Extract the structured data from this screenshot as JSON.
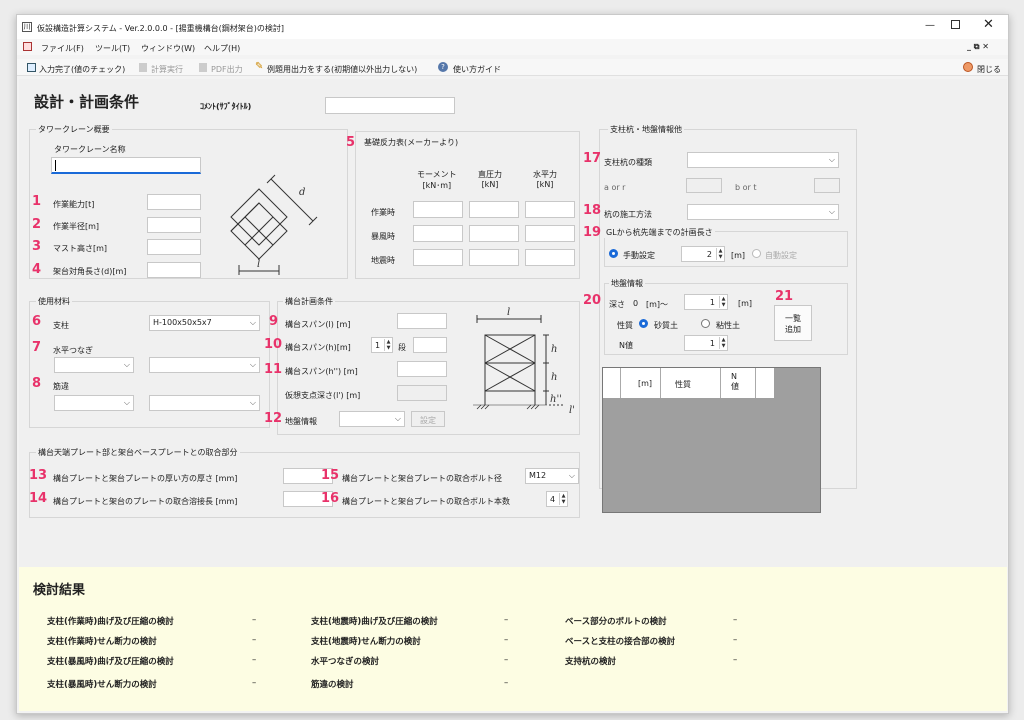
{
  "window": {
    "title": "仮設構造計算システム - Ver.2.0.0.0 - [揚重機構台(鋼材架台)の検討]"
  },
  "menu": [
    "ファイル(F)",
    "ツール(T)",
    "ウィンドウ(W)",
    "ヘルプ(H)"
  ],
  "toolbar": {
    "check": "入力完了(値のチェック)",
    "calc": "計算実行",
    "pdf": "PDF出力",
    "example": "例題用出力をする(初期値以外出力しない)",
    "guide": "使い方ガイド",
    "close": "閉じる"
  },
  "header": {
    "title": "設計・計画条件",
    "comment_label": "ｺﾒﾝﾄ(ｻﾌﾞﾀｲﾄﾙ)",
    "comment_value": ""
  },
  "tower": {
    "group": "タワークレーン概要",
    "name_label": "タワークレーン名称",
    "name_value": "",
    "capacity": "作業能力[t]",
    "radius": "作業半径[m]",
    "mast": "マスト高さ[m]",
    "diag": "架台対角長さ(d)[m]"
  },
  "reaction": {
    "group": "基礎反力表(メーカーより)",
    "moment": "モーメント\n[kN･m]",
    "vertical": "直圧力\n[kN]",
    "horizontal": "水平力\n[kN]",
    "rows": [
      "作業時",
      "暴風時",
      "地震時"
    ]
  },
  "pile": {
    "group": "支柱杭・地盤情報他",
    "type_label": "支柱杭の種類",
    "a_or_r": "a or r",
    "b_or_t": "b or t",
    "method_label": "杭の施工方法",
    "gl_group": "GLから杭先端までの計画長さ",
    "manual": "手動設定",
    "auto": "自動設定",
    "gl_value": "2",
    "unit_m": "[m]"
  },
  "ground": {
    "group": "地盤情報",
    "depth_label": "深さ",
    "depth_from": "0",
    "depth_to_unit": "[m]〜",
    "depth_value": "1",
    "unit_m": "[m]",
    "soil_label": "性質",
    "sand": "砂質土",
    "clay": "粘性土",
    "n_label": "N値",
    "n_value": "1",
    "add_button": "一覧\n追加",
    "table_headers": [
      "",
      "[m]",
      "性質",
      "N\n値"
    ]
  },
  "materials": {
    "group": "使用材料",
    "post": "支柱",
    "post_value": "H-100x50x5x7",
    "tie": "水平つなぎ",
    "brace": "筋違"
  },
  "plan": {
    "group": "構台計画条件",
    "span_l": "構台スパン(l)  [m]",
    "span_h": "構台スパン(h)[m]",
    "steps_value": "1",
    "steps": "段",
    "span_h2": "構台スパン(h'') [m]",
    "virtual": "仮想支点深さ(l') [m]",
    "ground": "地盤情報",
    "set": "設定"
  },
  "joint": {
    "group": "構台天端プレート部と架台ベースプレートとの取合部分",
    "thick": "構台プレートと架台プレートの厚い方の厚さ [mm]",
    "weld": "構台プレートと架台のプレートの取合溶接長 [mm]",
    "bolt_dia": "構台プレートと架台プレートの取合ボルト径",
    "bolt_dia_value": "M12",
    "bolt_num": "構台プレートと架台プレートの取合ボルト本数",
    "bolt_num_value": "4"
  },
  "markers": [
    "1",
    "2",
    "3",
    "4",
    "5",
    "6",
    "7",
    "8",
    "9",
    "10",
    "11",
    "12",
    "13",
    "14",
    "15",
    "16",
    "17",
    "18",
    "19",
    "20",
    "21"
  ],
  "results": {
    "title": "検討結果",
    "items": [
      {
        "label": "支柱(作業時)曲げ及び圧縮の検討",
        "value": "–"
      },
      {
        "label": "支柱(作業時)せん断力の検討",
        "value": "–"
      },
      {
        "label": "支柱(暴風時)曲げ及び圧縮の検討",
        "value": "–"
      },
      {
        "label": "支柱(暴風時)せん断力の検討",
        "value": "–"
      },
      {
        "label": "支柱(地震時)曲げ及び圧縮の検討",
        "value": "–"
      },
      {
        "label": "支柱(地震時)せん断力の検討",
        "value": "–"
      },
      {
        "label": "水平つなぎの検討",
        "value": "–"
      },
      {
        "label": "筋違の検討",
        "value": "–"
      },
      {
        "label": "ベース部分のボルトの検討",
        "value": "–"
      },
      {
        "label": "ベースと支柱の接合部の検討",
        "value": "–"
      },
      {
        "label": "支持杭の検討",
        "value": "–"
      }
    ]
  },
  "diagram_labels": {
    "d": "d",
    "l": "l",
    "h": "h",
    "h2": "h''",
    "lp": "l'"
  }
}
